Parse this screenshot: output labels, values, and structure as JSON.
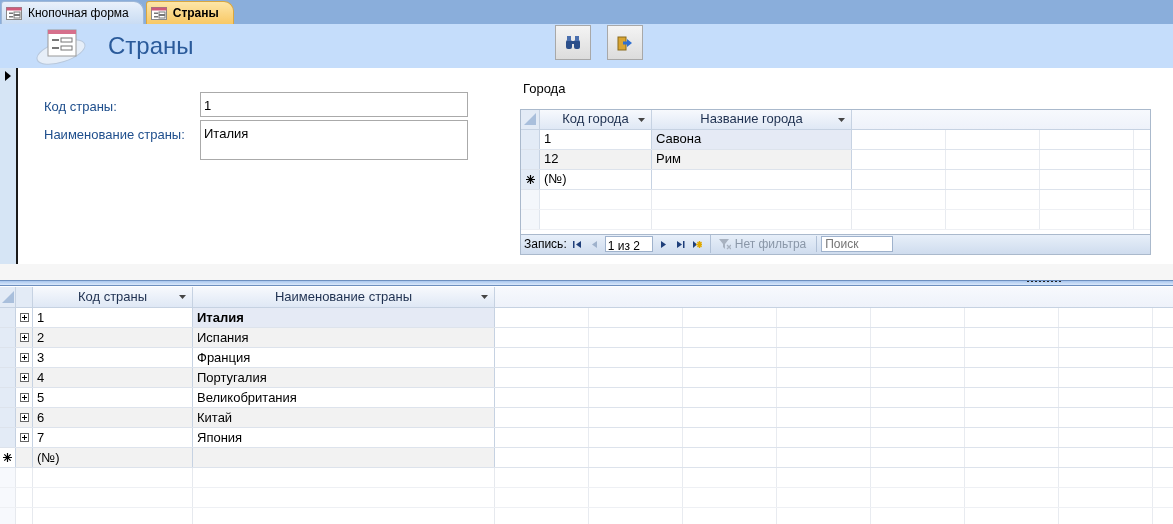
{
  "tabs": [
    {
      "label": "Кнопочная форма",
      "selected": false
    },
    {
      "label": "Страны",
      "selected": true
    }
  ],
  "form": {
    "title": "Страны",
    "fields": [
      {
        "label": "Код страны:",
        "value": "1",
        "kind": "line"
      },
      {
        "label": "Наименование страны:",
        "value": "Италия",
        "kind": "memo"
      }
    ],
    "subform": {
      "title": "Города",
      "columns": [
        "Код города",
        "Название города"
      ],
      "rows": [
        {
          "cells": [
            "1",
            "Савона"
          ],
          "selected": true
        },
        {
          "cells": [
            "12",
            "Рим"
          ],
          "selected": false
        }
      ],
      "new_row": "(№)",
      "navigation": {
        "label": "Запись:",
        "position": "1 из 2",
        "filter": "Нет фильтра",
        "search": {
          "placeholder": "Поиск"
        }
      }
    }
  },
  "datasheet": {
    "columns": [
      "Код страны",
      "Наименование страны"
    ],
    "rows": [
      {
        "cells": [
          "1",
          "Италия"
        ],
        "selected": true
      },
      {
        "cells": [
          "2",
          "Испания"
        ],
        "selected": false
      },
      {
        "cells": [
          "3",
          "Франция"
        ],
        "selected": false
      },
      {
        "cells": [
          "4",
          "Португалия"
        ],
        "selected": false
      },
      {
        "cells": [
          "5",
          "Великобритания"
        ],
        "selected": false
      },
      {
        "cells": [
          "6",
          "Китай"
        ],
        "selected": false
      },
      {
        "cells": [
          "7",
          "Япония"
        ],
        "selected": false
      }
    ],
    "new_row": "(№)"
  }
}
